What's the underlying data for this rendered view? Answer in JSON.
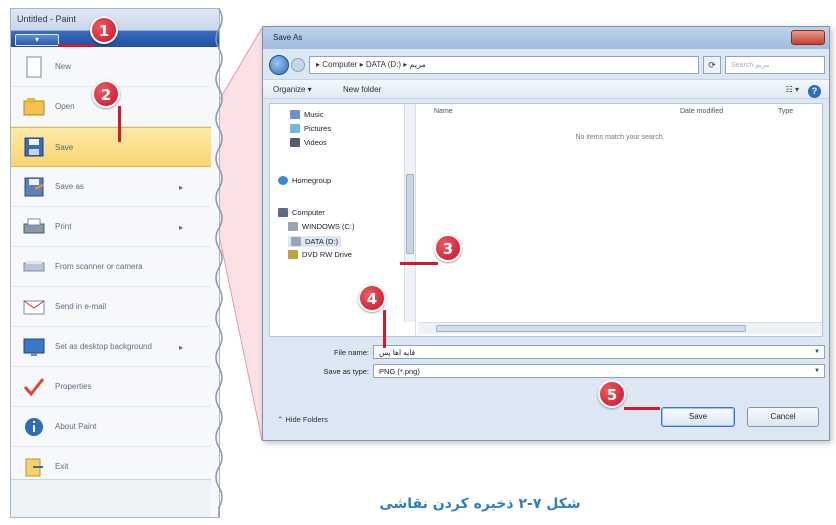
{
  "menu": {
    "title": "Untitled - Paint",
    "button_label": "▾",
    "items": [
      {
        "label": "New",
        "icon": "new-file-icon",
        "arrow": ""
      },
      {
        "label": "Open",
        "icon": "open-folder-icon",
        "arrow": ""
      },
      {
        "label": "Save",
        "icon": "floppy-disk-icon",
        "arrow": ""
      },
      {
        "label": "Save as",
        "icon": "save-as-icon",
        "arrow": "▸"
      },
      {
        "label": "Print",
        "icon": "printer-icon",
        "arrow": "▸"
      },
      {
        "label": "From scanner or camera",
        "icon": "scanner-icon",
        "arrow": ""
      },
      {
        "label": "Send in e-mail",
        "icon": "email-icon",
        "arrow": ""
      },
      {
        "label": "Set as desktop background",
        "icon": "desktop-background-icon",
        "arrow": "▸"
      },
      {
        "label": "Properties",
        "icon": "checkmark-icon",
        "arrow": ""
      },
      {
        "label": "About Paint",
        "icon": "info-icon",
        "arrow": ""
      },
      {
        "label": "Exit",
        "icon": "exit-icon",
        "arrow": ""
      }
    ]
  },
  "callouts": [
    "1",
    "2",
    "3",
    "4",
    "5"
  ],
  "dialog": {
    "title": "Save As",
    "address": "▸ Computer ▸ DATA (D:) ▸ مریم",
    "search_placeholder": "Search مریم",
    "organize": "Organize ▾",
    "new_folder": "New folder",
    "view_label": "☷ ▾",
    "help": "?",
    "nav_items": [
      {
        "label": "Music",
        "icon": "music-icon"
      },
      {
        "label": "Pictures",
        "icon": "pictures-icon"
      },
      {
        "label": "Videos",
        "icon": "videos-icon"
      },
      {
        "label": "Homegroup",
        "icon": "homegroup-icon"
      },
      {
        "label": "Computer",
        "icon": "computer-icon"
      },
      {
        "label": "WINDOWS (C:)",
        "icon": "drive-icon"
      },
      {
        "label": "DATA (D:)",
        "icon": "drive-icon"
      },
      {
        "label": "DVD RW Drive",
        "icon": "dvd-drive-icon"
      }
    ],
    "columns": [
      "Name",
      "Date modified",
      "Type"
    ],
    "empty_message": "No items match your search.",
    "file_name_label": "File name:",
    "file_name_value": "قایه اها پس",
    "save_type_label": "Save as type:",
    "save_type_value": "PNG (*.png)",
    "hide_folders": "Hide Folders",
    "save_button": "Save",
    "cancel_button": "Cancel"
  },
  "caption": "شکل ۷-۲ ذخیره کردن نقاشی"
}
